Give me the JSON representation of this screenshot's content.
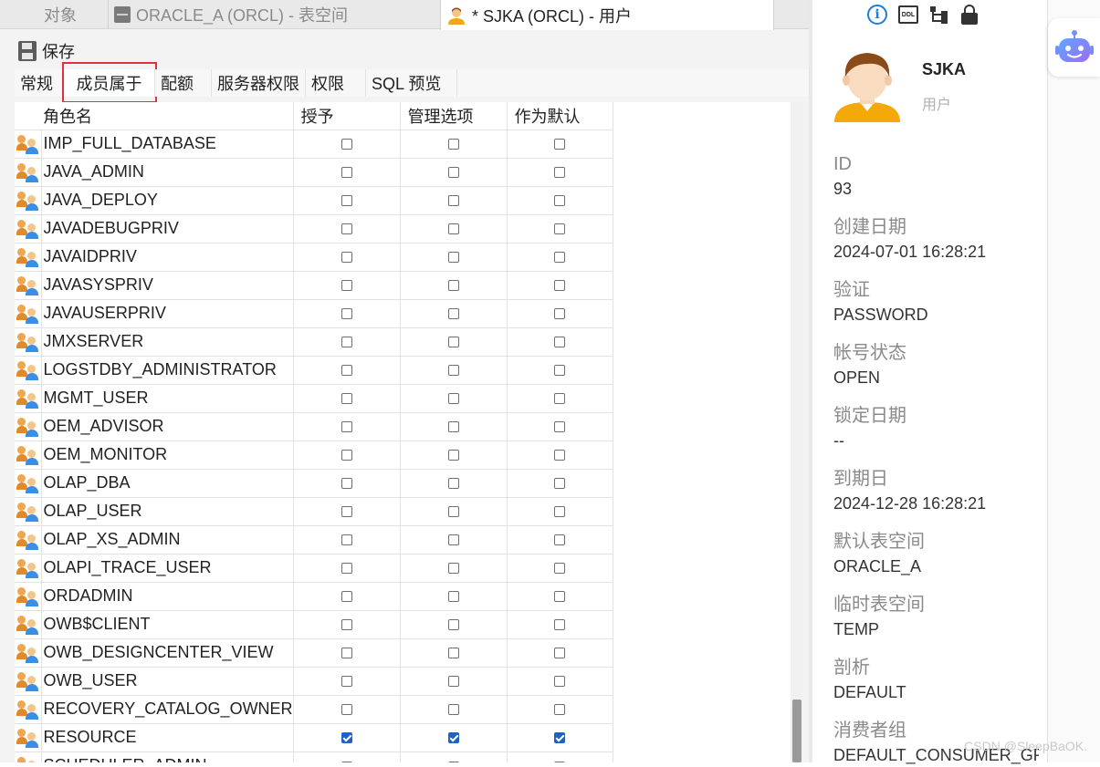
{
  "tabs": {
    "objects": "对象",
    "tablespace": "ORACLE_A (ORCL) - 表空间",
    "user": "* SJKA (ORCL) - 用户"
  },
  "toolbar": {
    "save_label": "保存"
  },
  "subtabs": [
    "常规",
    "成员属于",
    "配额",
    "服务器权限",
    "权限",
    "SQL 预览"
  ],
  "grid": {
    "headers": {
      "role": "角色名",
      "grant": "授予",
      "admin": "管理选项",
      "default": "作为默认"
    },
    "rows": [
      {
        "name": "IMP_FULL_DATABASE",
        "grant": false,
        "admin": false,
        "default": false
      },
      {
        "name": "JAVA_ADMIN",
        "grant": false,
        "admin": false,
        "default": false
      },
      {
        "name": "JAVA_DEPLOY",
        "grant": false,
        "admin": false,
        "default": false
      },
      {
        "name": "JAVADEBUGPRIV",
        "grant": false,
        "admin": false,
        "default": false
      },
      {
        "name": "JAVAIDPRIV",
        "grant": false,
        "admin": false,
        "default": false
      },
      {
        "name": "JAVASYSPRIV",
        "grant": false,
        "admin": false,
        "default": false
      },
      {
        "name": "JAVAUSERPRIV",
        "grant": false,
        "admin": false,
        "default": false
      },
      {
        "name": "JMXSERVER",
        "grant": false,
        "admin": false,
        "default": false
      },
      {
        "name": "LOGSTDBY_ADMINISTRATOR",
        "grant": false,
        "admin": false,
        "default": false
      },
      {
        "name": "MGMT_USER",
        "grant": false,
        "admin": false,
        "default": false
      },
      {
        "name": "OEM_ADVISOR",
        "grant": false,
        "admin": false,
        "default": false
      },
      {
        "name": "OEM_MONITOR",
        "grant": false,
        "admin": false,
        "default": false
      },
      {
        "name": "OLAP_DBA",
        "grant": false,
        "admin": false,
        "default": false
      },
      {
        "name": "OLAP_USER",
        "grant": false,
        "admin": false,
        "default": false
      },
      {
        "name": "OLAP_XS_ADMIN",
        "grant": false,
        "admin": false,
        "default": false
      },
      {
        "name": "OLAPI_TRACE_USER",
        "grant": false,
        "admin": false,
        "default": false
      },
      {
        "name": "ORDADMIN",
        "grant": false,
        "admin": false,
        "default": false
      },
      {
        "name": "OWB$CLIENT",
        "grant": false,
        "admin": false,
        "default": false
      },
      {
        "name": "OWB_DESIGNCENTER_VIEW",
        "grant": false,
        "admin": false,
        "default": false
      },
      {
        "name": "OWB_USER",
        "grant": false,
        "admin": false,
        "default": false
      },
      {
        "name": "RECOVERY_CATALOG_OWNER",
        "grant": false,
        "admin": false,
        "default": false
      },
      {
        "name": "RESOURCE",
        "grant": true,
        "admin": true,
        "default": true
      },
      {
        "name": "SCHEDULER_ADMIN",
        "grant": false,
        "admin": false,
        "default": false
      }
    ]
  },
  "panel": {
    "user_name": "SJKA",
    "user_type": "用户",
    "props": [
      {
        "key": "ID",
        "value": "93"
      },
      {
        "key": "创建日期",
        "value": "2024-07-01 16:28:21"
      },
      {
        "key": "验证",
        "value": "PASSWORD"
      },
      {
        "key": "帐号状态",
        "value": "OPEN"
      },
      {
        "key": "锁定日期",
        "value": "--"
      },
      {
        "key": "到期日",
        "value": "2024-12-28 16:28:21"
      },
      {
        "key": "默认表空间",
        "value": "ORACLE_A"
      },
      {
        "key": "临时表空间",
        "value": "TEMP"
      },
      {
        "key": "剖析",
        "value": "DEFAULT"
      },
      {
        "key": "消费者组",
        "value": "DEFAULT_CONSUMER_GROUP"
      }
    ],
    "ddl_label": "DDL"
  },
  "watermark": "CSDN @SleepBaOK."
}
